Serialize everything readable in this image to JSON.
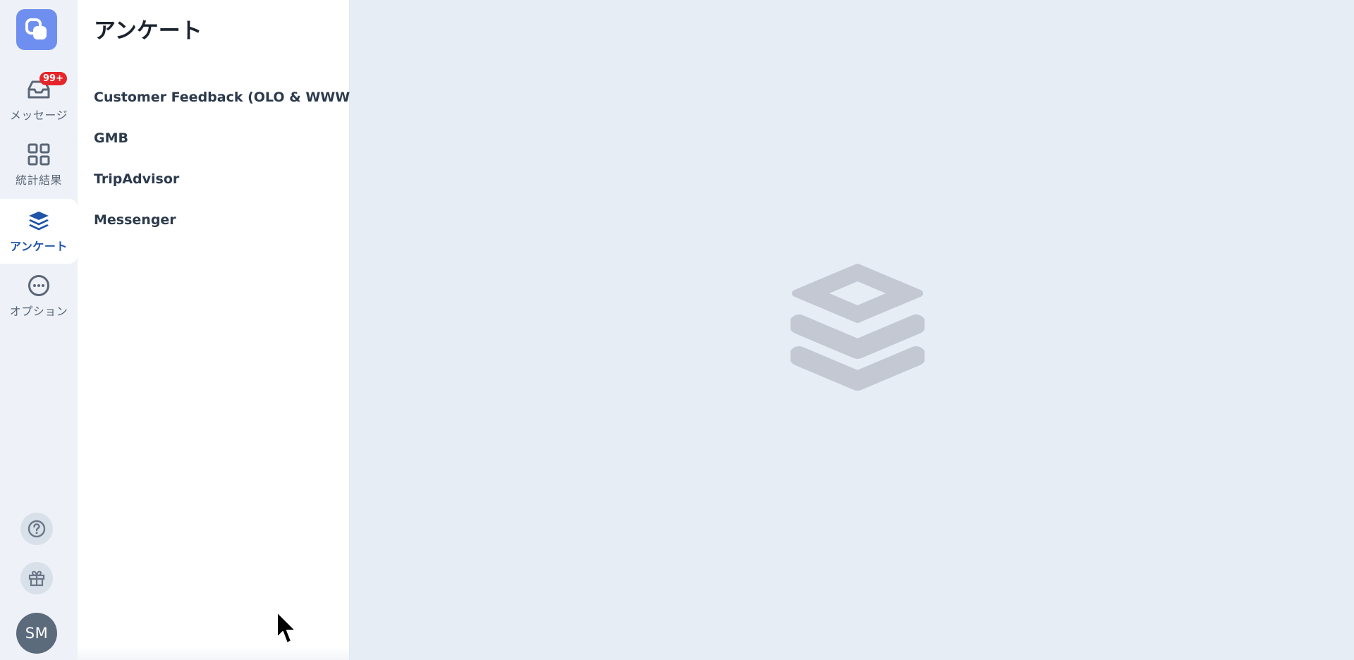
{
  "rail": {
    "messages": {
      "label": "メッセージ",
      "badge": "99+"
    },
    "stats": {
      "label": "統計結果"
    },
    "surveys": {
      "label": "アンケート"
    },
    "options": {
      "label": "オプション"
    },
    "user": {
      "initials": "SM"
    }
  },
  "panel": {
    "title": "アンケート",
    "items": [
      {
        "label": "Customer Feedback (OLO & WWW)"
      },
      {
        "label": "GMB"
      },
      {
        "label": "TripAdvisor"
      },
      {
        "label": "Messenger"
      }
    ]
  },
  "colors": {
    "accent": "#1f55a8",
    "logo": "#6f8ff0",
    "badge": "#e5252a",
    "avatar": "#5b6b7c"
  },
  "icons": {
    "logo": "app-logo-icon",
    "messages": "inbox-icon",
    "stats": "grid-icon",
    "surveys": "layers-icon",
    "options": "more-circle-icon",
    "help": "question-icon",
    "gift": "gift-icon",
    "empty": "layers-icon"
  }
}
